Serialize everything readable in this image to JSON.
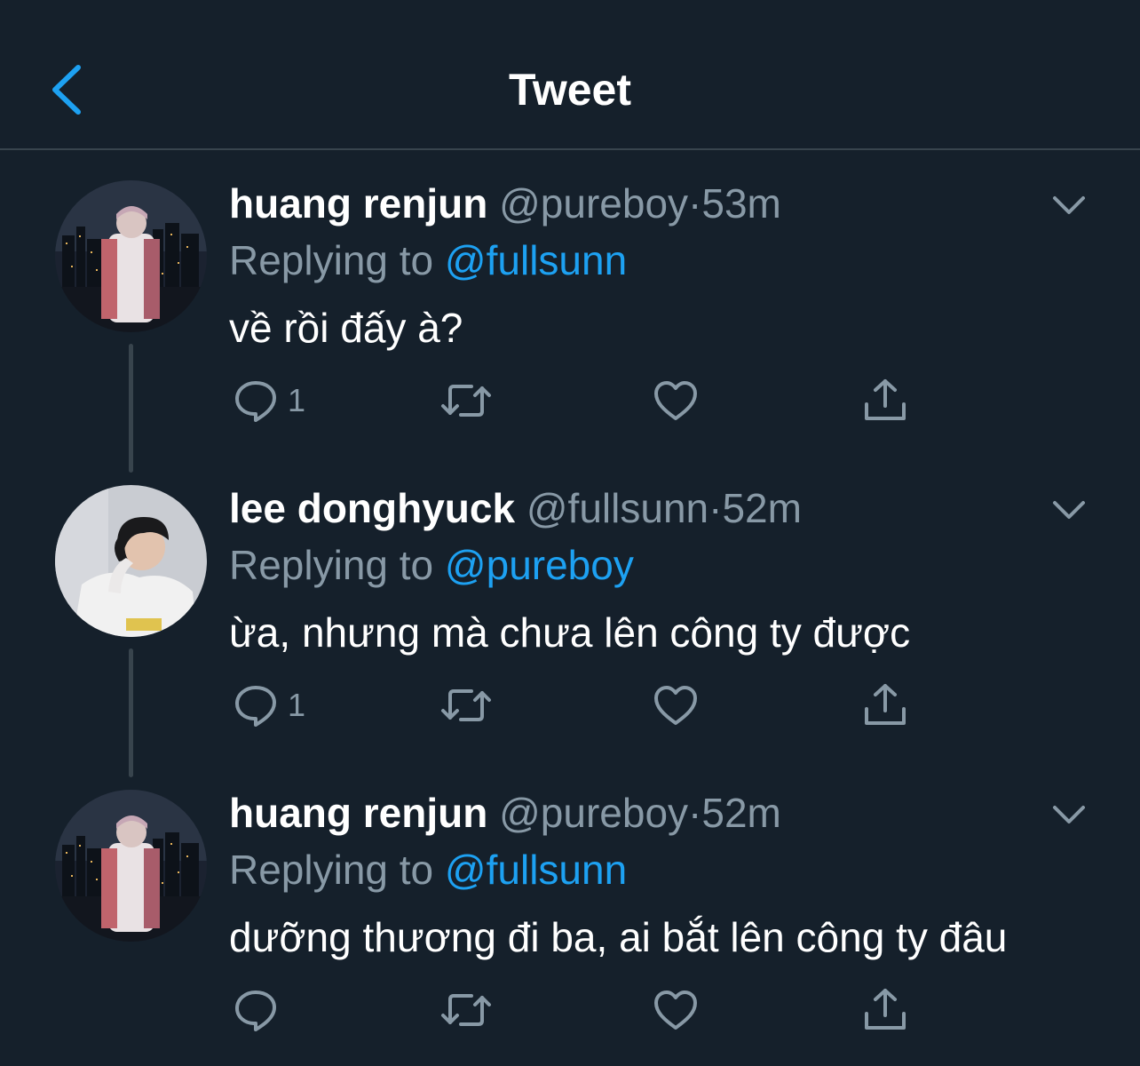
{
  "header": {
    "title": "Tweet",
    "back_icon": "chevron-left-icon",
    "accent": "#1da1f2"
  },
  "tweets": [
    {
      "name": "huang renjun",
      "handle": "@pureboy",
      "separator": "·",
      "time": "53m",
      "replying_prefix": "Replying to",
      "replying_to": "@fullsunn",
      "text": "về rồi đấy à?",
      "reply_count": "1",
      "avatar": "avatar-city-night"
    },
    {
      "name": "lee donghyuck",
      "handle": "@fullsunn",
      "separator": "·",
      "time": "52m",
      "replying_prefix": "Replying to",
      "replying_to": "@pureboy",
      "text": "ừa, nhưng mà chưa lên công ty được",
      "reply_count": "1",
      "avatar": "avatar-portrait"
    },
    {
      "name": "huang renjun",
      "handle": "@pureboy",
      "separator": "·",
      "time": "52m",
      "replying_prefix": "Replying to",
      "replying_to": "@fullsunn",
      "text": "dưỡng thương đi ba, ai bắt lên công ty đâu",
      "reply_count": "",
      "avatar": "avatar-city-night"
    }
  ],
  "colors": {
    "background": "#15202b",
    "divider": "#38444d",
    "secondary_text": "#8899a6",
    "mention": "#1da1f2"
  }
}
